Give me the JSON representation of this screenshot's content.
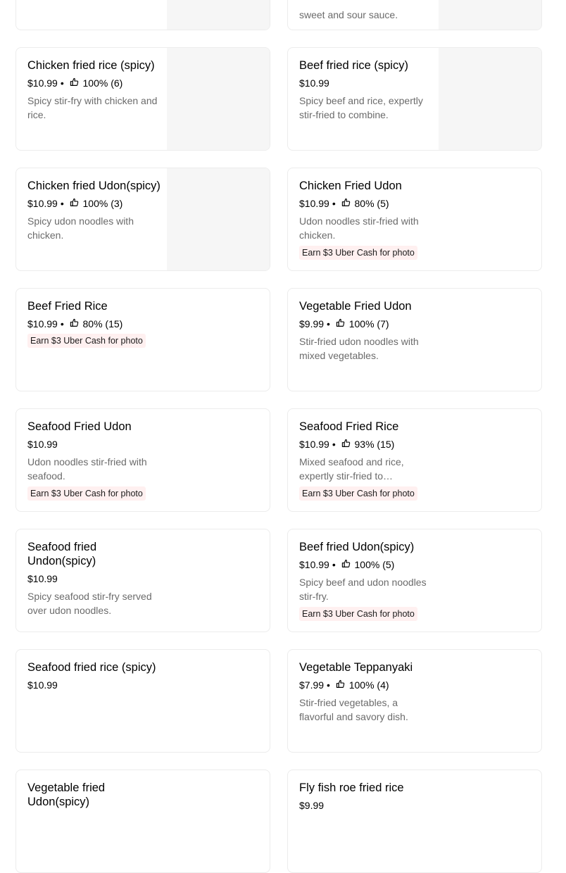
{
  "items": [
    {
      "title": "",
      "price": "",
      "rating": "",
      "description": "sweet and sour sauce.",
      "promo": "",
      "has_image": true
    },
    {
      "title": "Chicken fried rice (spicy)",
      "price": "$10.99",
      "rating": "100% (6)",
      "description": "Spicy stir-fry with chicken and rice.",
      "promo": "",
      "has_image": true
    },
    {
      "title": "Beef fried rice (spicy)",
      "price": "$10.99",
      "rating": "",
      "description": "Spicy beef and rice, expertly stir-fried to combine.",
      "promo": "",
      "has_image": true
    },
    {
      "title": "Chicken fried Udon(spicy)",
      "price": "$10.99",
      "rating": "100% (3)",
      "description": "Spicy udon noodles with chicken.",
      "promo": "",
      "has_image": true
    },
    {
      "title": "Chicken Fried Udon",
      "price": "$10.99",
      "rating": "80% (5)",
      "description": "Udon noodles stir-fried with chicken.",
      "promo": "Earn $3 Uber Cash for photo",
      "has_image": false
    },
    {
      "title": "Beef Fried Rice",
      "price": "$10.99",
      "rating": "80% (15)",
      "description": "",
      "promo": "Earn $3 Uber Cash for photo",
      "has_image": false
    },
    {
      "title": "Vegetable Fried Udon",
      "price": "$9.99",
      "rating": "100% (7)",
      "description": "Stir-fried udon noodles with mixed vegetables.",
      "promo": "",
      "has_image": false
    },
    {
      "title": "Seafood Fried Udon",
      "price": "$10.99",
      "rating": "",
      "description": "Udon noodles stir-fried with seafood.",
      "promo": "Earn $3 Uber Cash for photo",
      "has_image": false
    },
    {
      "title": "Seafood Fried Rice",
      "price": "$10.99",
      "rating": "93% (15)",
      "description": "Mixed seafood and rice, expertly stir-fried to…",
      "promo": "Earn $3 Uber Cash for photo",
      "has_image": false
    },
    {
      "title": "Seafood fried Undon(spicy)",
      "price": "$10.99",
      "rating": "",
      "description": "Spicy seafood stir-fry served over udon noodles.",
      "promo": "",
      "has_image": false
    },
    {
      "title": "Beef fried Udon(spicy)",
      "price": "$10.99",
      "rating": "100% (5)",
      "description": "Spicy beef and udon noodles stir-fry.",
      "promo": "Earn $3 Uber Cash for photo",
      "has_image": false
    },
    {
      "title": "Seafood fried rice (spicy)",
      "price": "$10.99",
      "rating": "",
      "description": "",
      "promo": "",
      "has_image": false
    },
    {
      "title": "Vegetable Teppanyaki",
      "price": "$7.99",
      "rating": "100% (4)",
      "description": "Stir-fried vegetables, a flavorful and savory dish.",
      "promo": "",
      "has_image": false
    },
    {
      "title": "Vegetable fried Udon(spicy)",
      "price": "",
      "rating": "",
      "description": "",
      "promo": "",
      "has_image": false
    },
    {
      "title": "Fly fish roe fried rice",
      "price": "$9.99",
      "rating": "",
      "description": "",
      "promo": "",
      "has_image": false
    }
  ],
  "first_card_left": {
    "has_image": true
  },
  "colors": {
    "promo_bg": "#fff0f0",
    "muted_text": "#6b6b6b",
    "image_placeholder": "#f6f6f6"
  },
  "icons": {
    "rating": "thumbs-up-icon"
  },
  "separator": "•"
}
